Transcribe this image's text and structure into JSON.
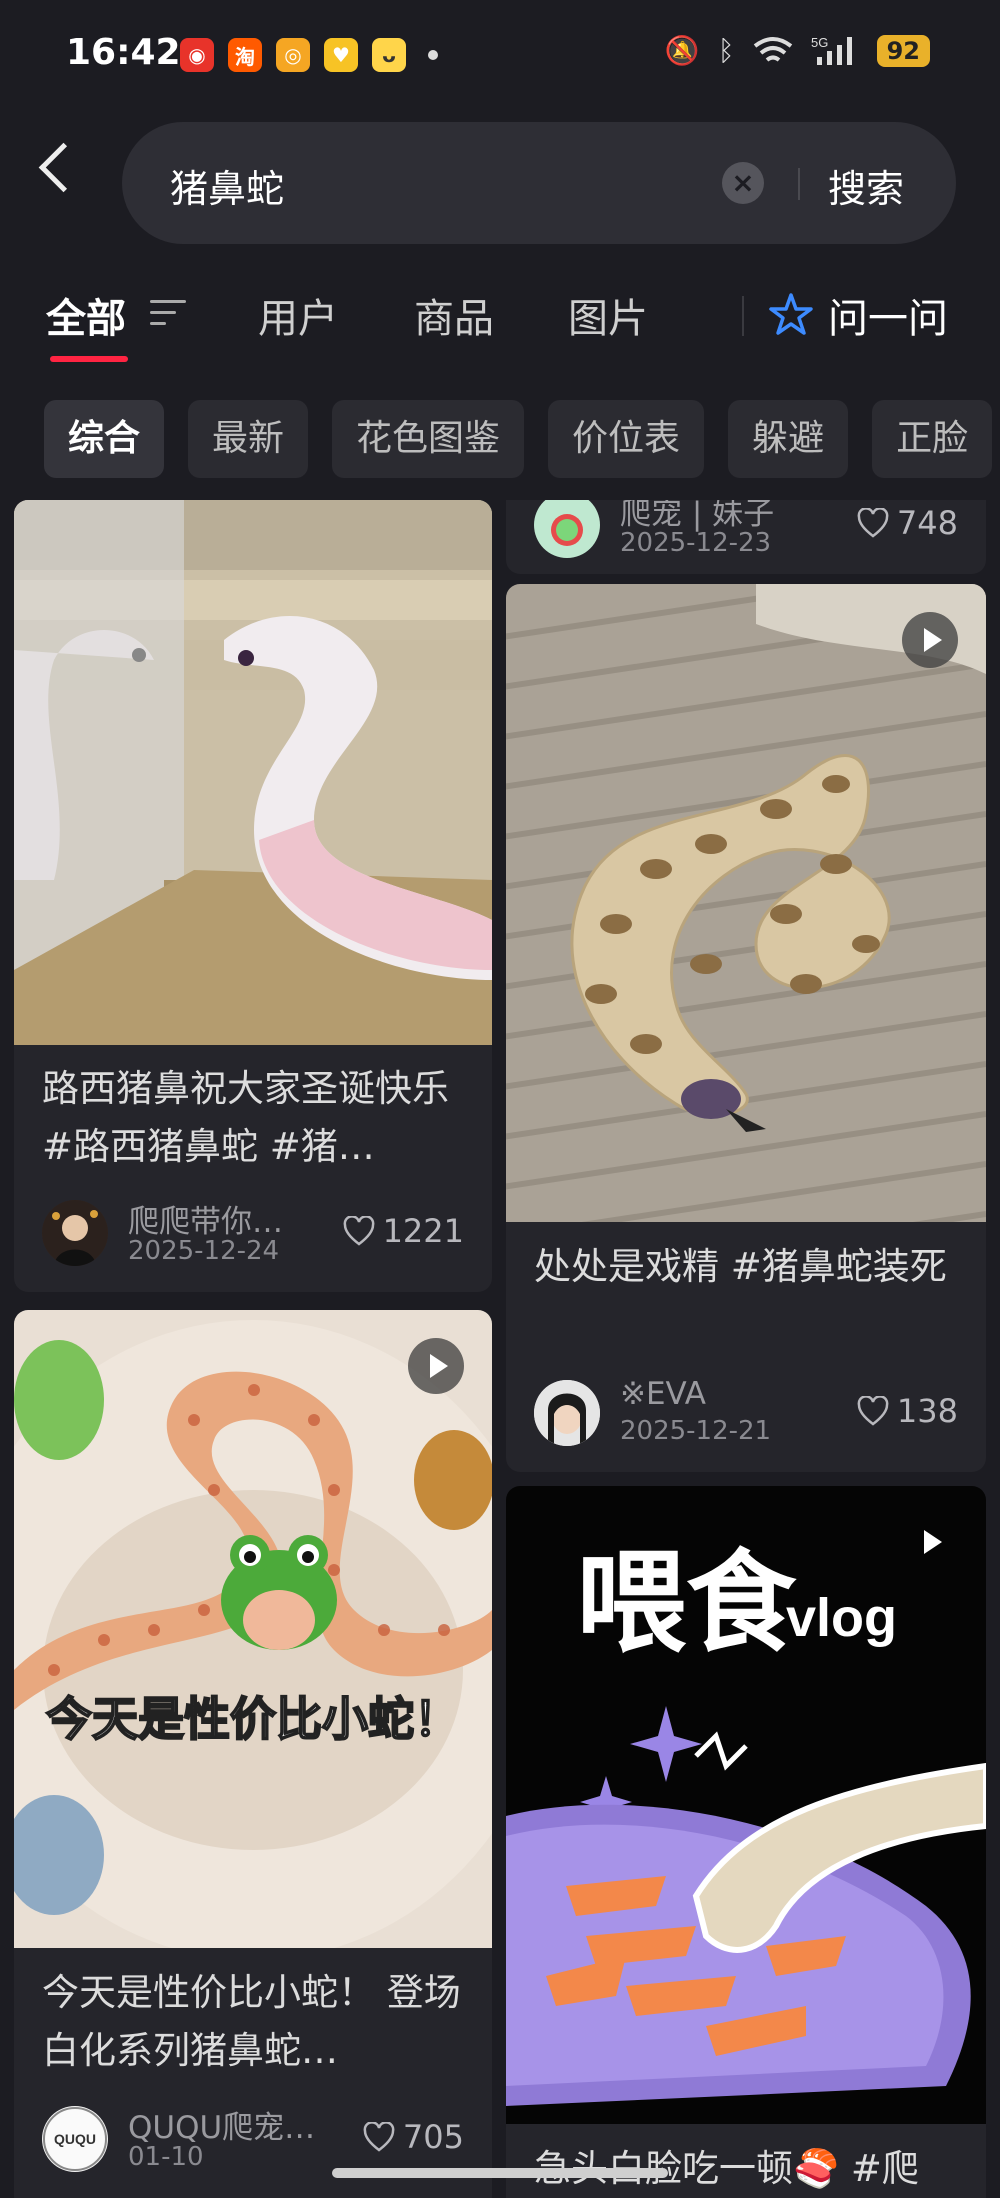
{
  "status_bar": {
    "time": "16:42",
    "network": "5G",
    "battery": "92"
  },
  "search": {
    "query": "猪鼻蛇",
    "button_label": "搜索"
  },
  "tabs": [
    {
      "label": "全部",
      "active": true
    },
    {
      "label": "用户"
    },
    {
      "label": "商品"
    },
    {
      "label": "图片"
    }
  ],
  "ask_label": "问一问",
  "chips": [
    "综合",
    "最新",
    "花色图鉴",
    "价位表",
    "躲避",
    "正脸"
  ],
  "posts": {
    "top_right_partial": {
      "author": "爬宠 | 妹子",
      "date": "2025-12-23",
      "likes": "748"
    },
    "post1": {
      "title": "路西猪鼻祝大家圣诞快乐 #路西猪鼻蛇 #猪…",
      "author": "爬爬带你…",
      "date": "2025-12-24",
      "likes": "1221"
    },
    "post2": {
      "title": "处处是戏精 #猪鼻蛇装死",
      "author": "※EVA",
      "date": "2025-12-21",
      "likes": "138"
    },
    "post3": {
      "image_text": "今天是性价比小蛇！",
      "title": "今天是性价比小蛇！ 登场白化系列猪鼻蛇…",
      "author": "QUQU爬宠…",
      "avatar_text": "QUQU",
      "date": "01-10",
      "likes": "705"
    },
    "post4": {
      "image_text_main": "喂食",
      "image_text_sub": "vlog",
      "title": "急头白脸吃一顿🍣 #爬"
    }
  },
  "colors": {
    "background": "#1c1c22",
    "accent": "#ff2442",
    "ask_icon": "#3d8bff",
    "battery": "#e9b12a"
  }
}
